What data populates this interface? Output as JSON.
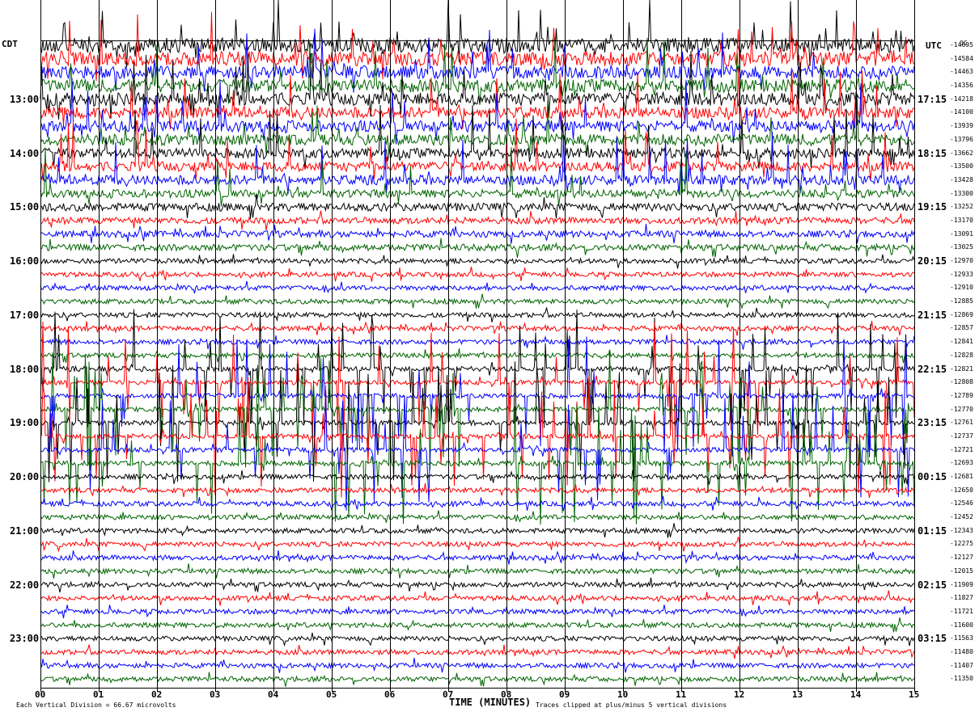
{
  "chart_data": {
    "type": "line",
    "left_zone": "CDT",
    "right_zone": "UTC",
    "right_top_code": "OC",
    "left_hours": [
      "13:00",
      "14:00",
      "15:00",
      "16:00",
      "17:00",
      "18:00",
      "19:00",
      "20:00",
      "21:00",
      "22:00",
      "23:00"
    ],
    "right_hours": [
      "17:15",
      "18:15",
      "19:15",
      "20:15",
      "21:15",
      "22:15",
      "23:15",
      "00:15",
      "01:15",
      "02:15",
      "03:15"
    ],
    "x_ticks": [
      "00",
      "01",
      "02",
      "03",
      "04",
      "05",
      "06",
      "07",
      "08",
      "09",
      "10",
      "11",
      "12",
      "13",
      "14",
      "15"
    ],
    "xlabel": "TIME (MINUTES)",
    "xlim": [
      0,
      15
    ],
    "trace_count": 48,
    "trace_colors": [
      "#000000",
      "#ff0000",
      "#0000ff",
      "#006400"
    ],
    "grid": true,
    "scale_note": "Each Vertical Division =    66.67 microvolts",
    "clip_note": "Traces clipped at plus/minus 5 vertical divisions",
    "amplitude_profile": [
      9,
      9,
      8,
      8,
      8,
      7,
      7,
      7,
      6,
      6,
      6,
      5,
      5,
      4,
      4,
      4,
      3,
      3,
      3,
      3,
      3,
      3,
      3,
      3,
      3,
      3,
      3,
      3,
      3,
      3,
      3,
      3,
      3,
      3,
      3,
      3,
      3,
      3,
      3,
      3,
      3,
      3,
      3,
      3,
      3,
      3,
      3,
      3
    ],
    "strong_noise_traces": [
      24,
      25,
      26,
      27,
      28,
      29,
      30,
      31
    ],
    "offsets": [
      "-14695",
      "-14584",
      "-14463",
      "-14356",
      "-14218",
      "-14100",
      "-13939",
      "-13796",
      "-13662",
      "-13500",
      "-13428",
      "-13300",
      "-13252",
      "-13170",
      "-13091",
      "-13025",
      "-12970",
      "-12933",
      "-12910",
      "-12885",
      "-12869",
      "-12857",
      "-12841",
      "-12828",
      "-12821",
      "-12808",
      "-12789",
      "-12770",
      "-12761",
      "-12737",
      "-12721",
      "-12693",
      "-12681",
      "-12650",
      "-12546",
      "-12452",
      "-12343",
      "-12275",
      "-12127",
      "-12015",
      "-11909",
      "-11827",
      "-11721",
      "-11600",
      "-11563",
      "-11480",
      "-11407",
      "-11350"
    ]
  }
}
